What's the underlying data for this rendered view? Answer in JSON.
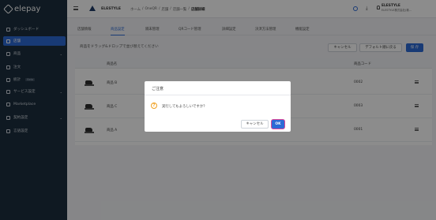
{
  "app": {
    "logo_text": "elepay"
  },
  "sidebar": {
    "items": [
      {
        "label": "ダッシュボード",
        "icon": "dashboard-icon"
      },
      {
        "label": "店舗",
        "icon": "store-icon",
        "active": true
      },
      {
        "label": "商品",
        "icon": "product-icon",
        "has_children": true
      },
      {
        "label": "注文",
        "icon": "order-icon"
      },
      {
        "label": "統計",
        "icon": "stats-icon",
        "badge": "Beta"
      },
      {
        "label": "サービス設定",
        "icon": "service-icon",
        "has_children": true
      },
      {
        "label": "Marketplace",
        "icon": "marketplace-icon"
      },
      {
        "label": "契約設定",
        "icon": "contract-icon",
        "has_children": true
      },
      {
        "label": "言語設定",
        "icon": "language-icon"
      }
    ]
  },
  "header": {
    "brand": "ELESTYLE",
    "breadcrumb": [
      "ホーム",
      "OneQR",
      "店舗",
      "店舗一覧",
      "店舗詳細"
    ],
    "breadcrumb_sep": "/",
    "user_name": "ELESTYLE",
    "user_sub": "ELESTYLE株式会社(検..."
  },
  "tabs": [
    {
      "label": "店舗情報"
    },
    {
      "label": "商品設定",
      "active": true
    },
    {
      "label": "隔末管理"
    },
    {
      "label": "QRコード管理"
    },
    {
      "label": "詳細設定"
    },
    {
      "label": "決済方法管理"
    },
    {
      "label": "機能設定"
    }
  ],
  "toolbar": {
    "hint": "商品をドラッグ&ドロップで並び替えてください",
    "cancel_label": "キャンセル",
    "default_order_label": "デフォルト順に戻る",
    "save_label": "保 存"
  },
  "table": {
    "headers": {
      "name": "商品名",
      "code": "商品コード"
    },
    "rows": [
      {
        "name": "商品 B",
        "code": "0002"
      },
      {
        "name": "商品 C",
        "code": "0003"
      },
      {
        "name": "商品 A",
        "code": "0001"
      }
    ]
  },
  "dialog": {
    "title": "ご注意",
    "message": "実行してもよろしいですか？",
    "cancel_label": "キャンセル",
    "ok_label": "OK"
  },
  "colors": {
    "primary": "#2d6bd6",
    "sidebar_bg": "#1c2e3e",
    "focus_ring": "#e0489a",
    "warning": "#f0a020"
  }
}
